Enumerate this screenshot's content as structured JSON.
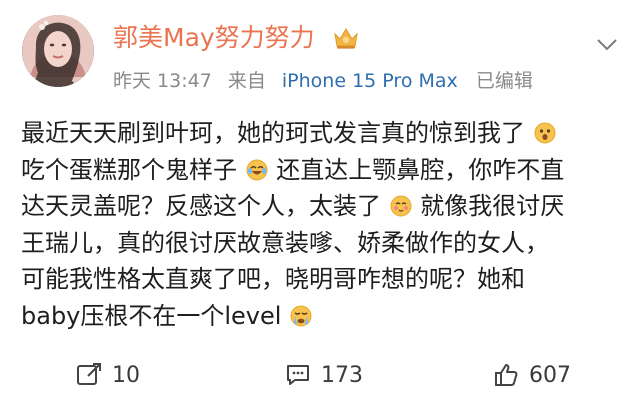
{
  "user": {
    "name": "郭美May努力努力",
    "time": "昨天 13:47",
    "from_label": "来自",
    "device": "iPhone 15 Pro Max",
    "edited": "已编辑"
  },
  "post": {
    "lines": [
      [
        "最近天天刷到叶珂，她的珂式发言真的惊到我了",
        "{emoji:shock}"
      ],
      [
        "吃个蛋糕那个鬼样子",
        "{emoji:laugh-cry}",
        "还直达上颚鼻腔，你咋不直"
      ],
      [
        "达天灵盖呢？反感这个人，太装了",
        "{emoji:blush}",
        "就像我很讨厌"
      ],
      [
        "王瑞儿，真的很讨厌故意装嗲、娇柔做作的女人，"
      ],
      [
        "可能我性格太直爽了吧，晓明哥咋想的呢？她和"
      ],
      [
        "baby压根不在一个level",
        "{emoji:cry}"
      ]
    ]
  },
  "actions": {
    "repost_count": "10",
    "comment_count": "173",
    "like_count": "607"
  },
  "colors": {
    "username": "#eb7350",
    "device": "#2f6fb0",
    "meta": "#8a8a8a"
  },
  "icons": {
    "vip_badge": "crown-vip-icon",
    "more": "chevron-down-icon",
    "repost": "repost-icon",
    "comment": "comment-icon",
    "like": "thumbs-up-icon"
  }
}
